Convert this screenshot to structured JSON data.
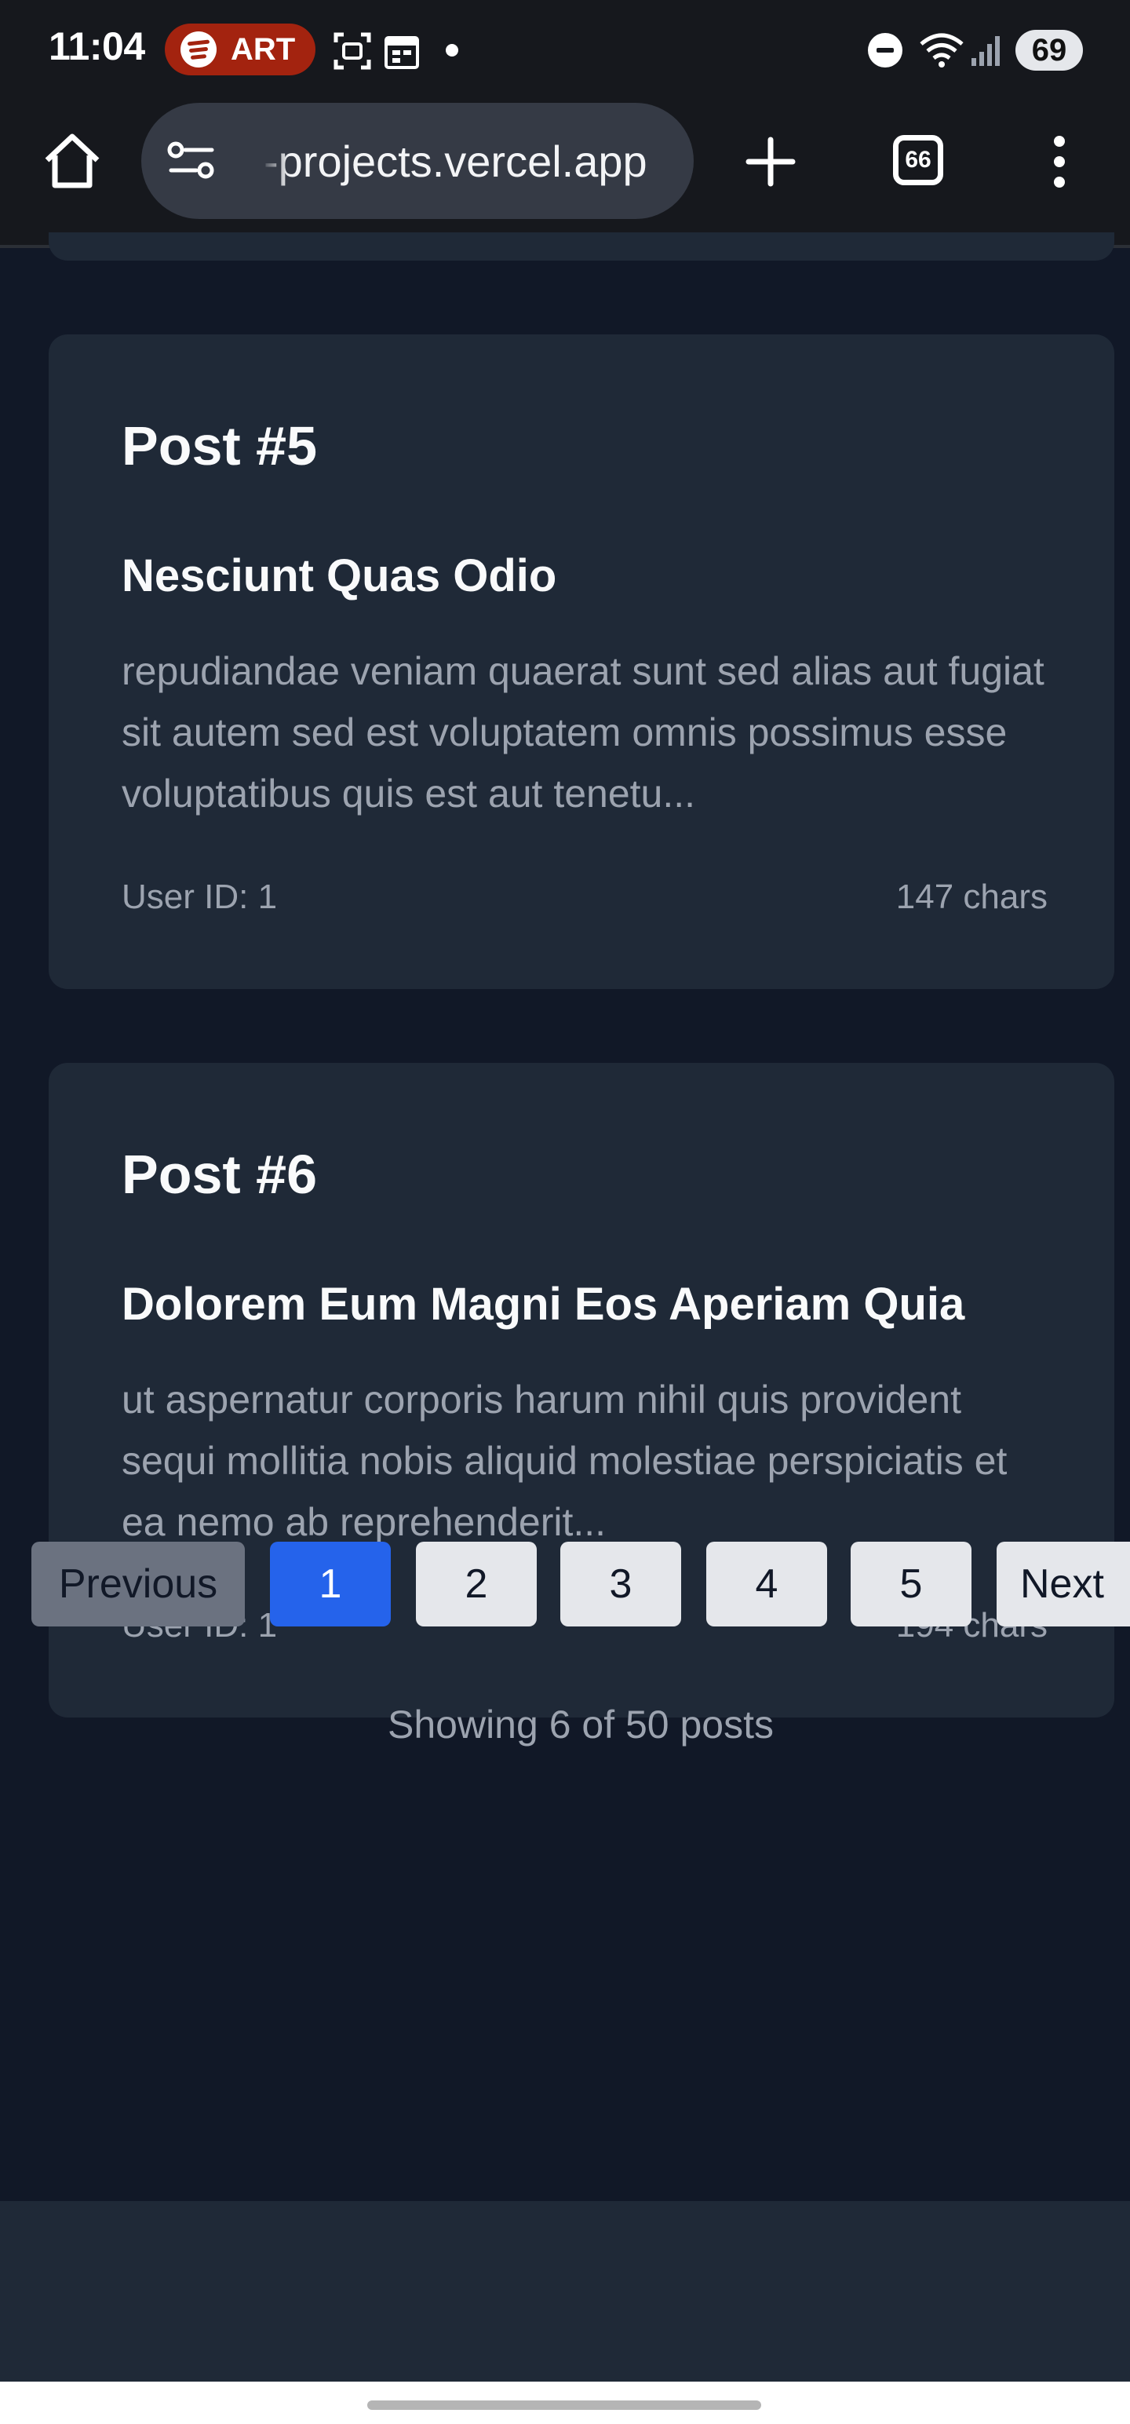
{
  "status_bar": {
    "time": "11:04",
    "media_label": "ART",
    "battery": "69"
  },
  "browser": {
    "url": "-projects.vercel.app",
    "tab_count": "66"
  },
  "posts": [
    {
      "number": "Post #5",
      "title": "Nesciunt Quas Odio",
      "body": "repudiandae veniam quaerat sunt sed alias aut fugiat sit autem sed est voluptatem omnis possimus esse voluptatibus quis est aut tenetu...",
      "user": "User ID: 1",
      "chars": "147 chars"
    },
    {
      "number": "Post #6",
      "title": "Dolorem Eum Magni Eos Aperiam Quia",
      "body": "ut aspernatur corporis harum nihil quis provident sequi mollitia nobis aliquid molestiae perspiciatis et ea nemo ab reprehenderit...",
      "user": "User ID: 1",
      "chars": "194 chars"
    }
  ],
  "pagination": {
    "previous": "Previous",
    "pages": [
      "1",
      "2",
      "3",
      "4",
      "5"
    ],
    "active_page": "1",
    "next": "Next"
  },
  "showing_text": "Showing 6 of 50 posts",
  "colors": {
    "page_bg": "#111827",
    "card_bg": "#1f2937",
    "active_page": "#2563eb",
    "spotify_pill": "#a3230f"
  }
}
